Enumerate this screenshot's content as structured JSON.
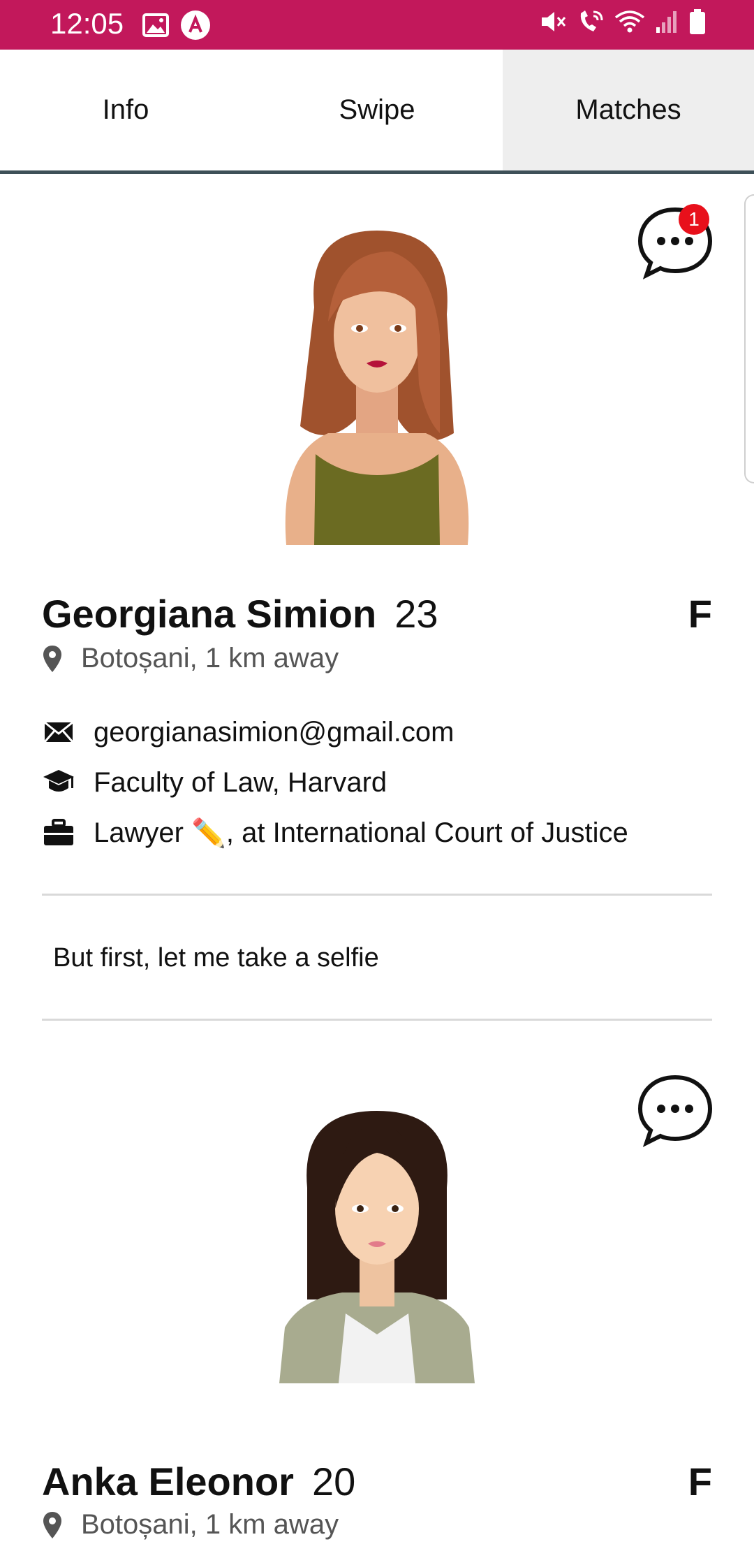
{
  "status_bar": {
    "time": "12:05",
    "left_icons": [
      "image-icon",
      "app-a-icon"
    ],
    "right_icons": [
      "mute-icon",
      "wifi-call-icon",
      "wifi-icon",
      "signal-icon",
      "battery-icon"
    ],
    "color": "#c2185b"
  },
  "tabs": [
    {
      "label": "Info",
      "active": false
    },
    {
      "label": "Swipe",
      "active": false
    },
    {
      "label": "Matches",
      "active": true
    }
  ],
  "matches": [
    {
      "name": "Georgiana Simion",
      "age": "23",
      "gender": "F",
      "location": "Botoșani, 1 km away",
      "email": "georgianasimion@gmail.com",
      "education": "Faculty of Law, Harvard",
      "job_prefix": "Lawyer ",
      "job_emoji": "✏️",
      "job_suffix": ", at International Court of Justice",
      "bio": "But first, let me take a selfie",
      "unread_badge": "1",
      "avatar_icon": "woman-auburn-hair-avatar"
    },
    {
      "name": "Anka Eleonor",
      "age": "20",
      "gender": "F",
      "location": "Botoșani, 1 km away",
      "avatar_icon": "woman-dark-hair-avatar"
    }
  ]
}
